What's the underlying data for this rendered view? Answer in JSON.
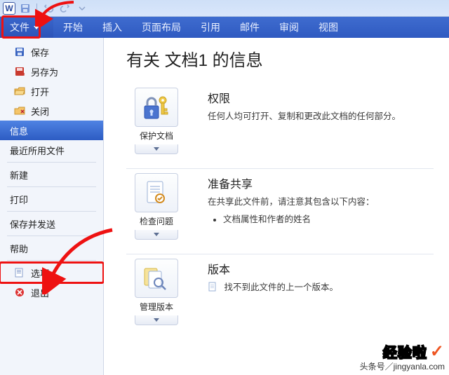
{
  "titlebar": {
    "app_letter": "W"
  },
  "ribbon": {
    "file": "文件",
    "tabs": [
      "开始",
      "插入",
      "页面布局",
      "引用",
      "邮件",
      "审阅",
      "视图"
    ]
  },
  "sidebar": {
    "group1": {
      "save": "保存",
      "saveas": "另存为",
      "open": "打开",
      "close": "关闭"
    },
    "active": "信息",
    "mid": {
      "recent": "最近所用文件",
      "new_": "新建",
      "print": "打印",
      "sharesend": "保存并发送",
      "help": "帮助"
    },
    "bottom": {
      "options": "选项",
      "exit": "退出"
    }
  },
  "main": {
    "title": "有关 文档1 的信息",
    "perm": {
      "button": "保护文档",
      "heading": "权限",
      "body": "任何人均可打开、复制和更改此文档的任何部分。"
    },
    "share": {
      "button": "检查问题",
      "heading": "准备共享",
      "body": "在共享此文件前，请注意其包含以下内容：",
      "item1": "文档属性和作者的姓名"
    },
    "ver": {
      "button": "管理版本",
      "heading": "版本",
      "body": "找不到此文件的上一个版本。"
    }
  },
  "watermark": {
    "brand": "经验啦",
    "url": "头条号／jingyanla.com"
  }
}
